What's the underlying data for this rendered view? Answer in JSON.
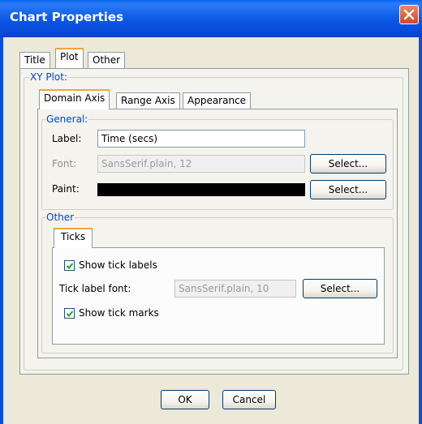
{
  "window": {
    "title": "Chart Properties"
  },
  "top_tabs": [
    {
      "label": "Title"
    },
    {
      "label": "Plot"
    },
    {
      "label": "Other"
    }
  ],
  "xy_plot": {
    "group_label": "XY Plot:"
  },
  "axis_tabs": [
    {
      "label": "Domain Axis"
    },
    {
      "label": "Range Axis"
    },
    {
      "label": "Appearance"
    }
  ],
  "general": {
    "group_label": "General:",
    "label_caption": "Label:",
    "label_value": "Time (secs)",
    "font_caption": "Font:",
    "font_value": "SansSerif.plain, 12",
    "paint_caption": "Paint:",
    "paint_color": "#000000",
    "select_label": "Select..."
  },
  "other": {
    "group_label": "Other",
    "ticks_tab": "Ticks",
    "show_tick_labels": "Show tick labels",
    "show_tick_labels_checked": true,
    "tick_font_caption": "Tick label font:",
    "tick_font_value": "SansSerif.plain, 10",
    "select_label": "Select...",
    "show_tick_marks": "Show tick marks",
    "show_tick_marks_checked": true
  },
  "buttons": {
    "ok": "OK",
    "cancel": "Cancel"
  }
}
